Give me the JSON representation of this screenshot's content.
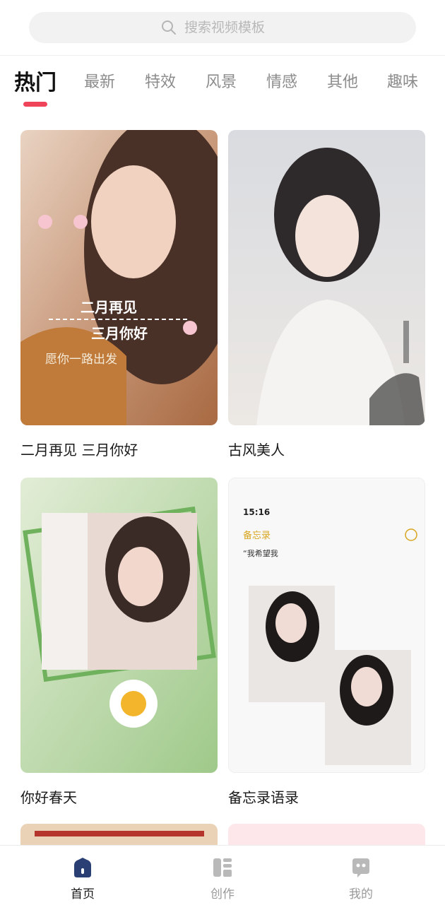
{
  "search": {
    "placeholder": "搜索视频模板",
    "icon": "search-icon"
  },
  "tabs": [
    {
      "label": "热门",
      "active": true
    },
    {
      "label": "最新",
      "active": false
    },
    {
      "label": "特效",
      "active": false
    },
    {
      "label": "风景",
      "active": false
    },
    {
      "label": "情感",
      "active": false
    },
    {
      "label": "其他",
      "active": false
    },
    {
      "label": "趣味",
      "active": false
    }
  ],
  "accent_color": "#f0445a",
  "cards": [
    {
      "title": "二月再见 三月你好",
      "overlay": {
        "line1": "二月再见",
        "line2": "三月你好",
        "line3": "愿你一路出发"
      }
    },
    {
      "title": "古风美人"
    },
    {
      "title": "你好春天"
    },
    {
      "title": "备忘录语录",
      "overlay": {
        "time": "15:16",
        "back": "备忘录",
        "quote": "“我希望我"
      }
    }
  ],
  "bottom_nav": [
    {
      "label": "首页",
      "icon": "home-icon",
      "active": true
    },
    {
      "label": "创作",
      "icon": "create-icon",
      "active": false
    },
    {
      "label": "我的",
      "icon": "profile-icon",
      "active": false
    }
  ]
}
